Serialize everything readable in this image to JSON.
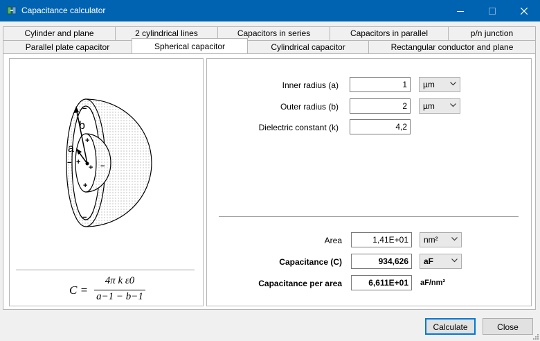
{
  "window": {
    "title": "Capacitance calculator"
  },
  "tabs": {
    "row1": [
      "Cylinder and plane",
      "2 cylindrical lines",
      "Capacitors in series",
      "Capacitors in parallel",
      "p/n junction"
    ],
    "row2": [
      "Parallel plate capacitor",
      "Spherical capacitor",
      "Cylindrical capacitor",
      "Rectangular conductor and plane"
    ],
    "active": "Spherical capacitor"
  },
  "diagram": {
    "labels": {
      "b": "b",
      "a": "a",
      "plus": "+",
      "minus": "−"
    },
    "formula": {
      "lhs": "C =",
      "numerator": "4π k ε0",
      "denominator": "a−1 − b−1"
    }
  },
  "inputs": {
    "inner_radius": {
      "label": "Inner radius (a)",
      "value": "1",
      "unit": "µm"
    },
    "outer_radius": {
      "label": "Outer radius (b)",
      "value": "2",
      "unit": "µm"
    },
    "dielectric": {
      "label": "Dielectric constant (k)",
      "value": "4,2"
    }
  },
  "results": {
    "area": {
      "label": "Area",
      "value": "1,41E+01",
      "unit": "nm²"
    },
    "capacitance": {
      "label": "Capacitance (C)",
      "value": "934,626",
      "unit": "aF"
    },
    "capacitance_per_area": {
      "label": "Capacitance per area",
      "value": "6,611E+01",
      "unit": "aF/nm²"
    }
  },
  "buttons": {
    "calculate": "Calculate",
    "close": "Close"
  },
  "colors": {
    "titlebar": "#0063b1",
    "default_border": "#0078d7"
  }
}
